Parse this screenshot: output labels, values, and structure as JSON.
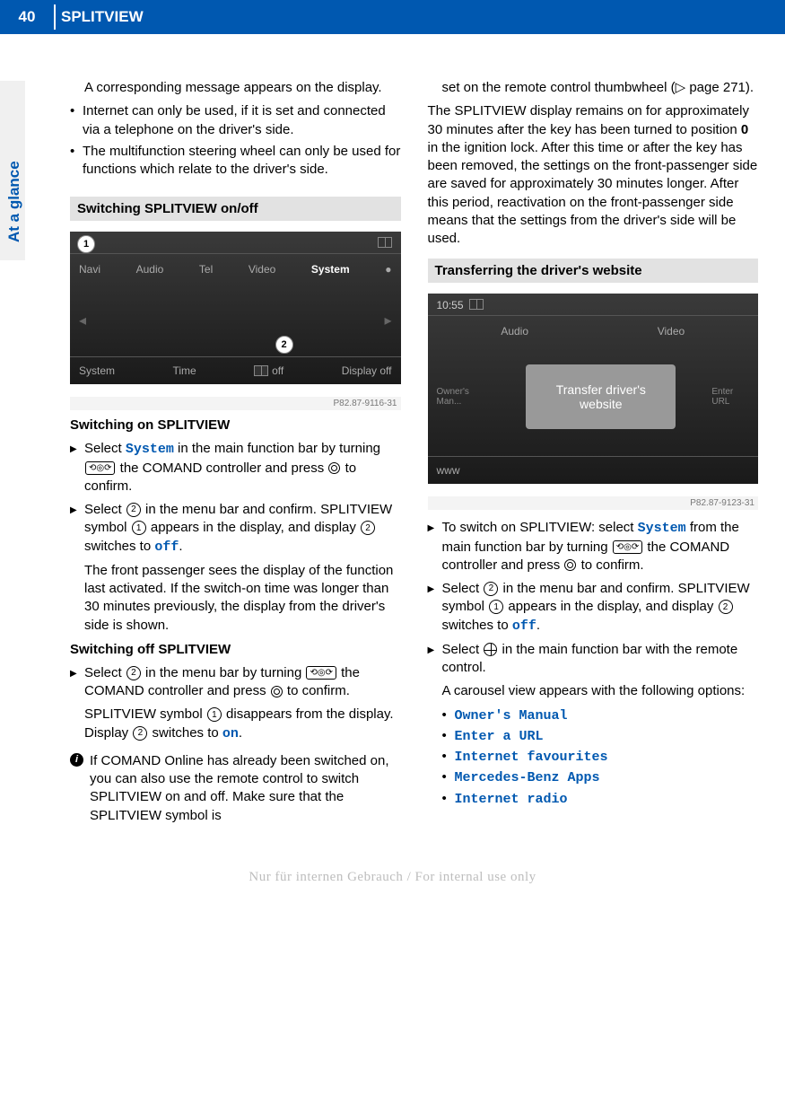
{
  "header": {
    "page_number": "40",
    "chapter": "SPLITVIEW",
    "side_tab": "At a glance"
  },
  "left": {
    "intro": "A corresponding message appears on the display.",
    "bul1": "Internet can only be used, if it is set and connected via a telephone on the driver's side.",
    "bul2": "The multifunction steering wheel can only be used for functions which relate to the driver's side.",
    "section1": "Switching SPLITVIEW on/off",
    "screenshot": {
      "nav": {
        "i1": "Navi",
        "i2": "Audio",
        "i3": "Tel",
        "i4": "Video",
        "i5": "System"
      },
      "bot": {
        "i1": "System",
        "i2": "Time",
        "i3": "off",
        "i4": "Display off"
      },
      "id": "P82.87-9116-31"
    },
    "swon_head": "Switching on SPLITVIEW",
    "swon_s1a": "Select ",
    "swon_s1_cmd": "System",
    "swon_s1b": " in the main function bar by turning ",
    "swon_s1c": " the COMAND controller and press ",
    "swon_s1d": " to confirm.",
    "swon_s2a": "Select ",
    "swon_s2b": " in the menu bar and confirm. SPLITVIEW symbol ",
    "swon_s2c": " appears in the display, and display ",
    "swon_s2d": " switches to ",
    "swon_s2_cmd": "off",
    "swon_s2e": ".",
    "swon_body": "The front passenger sees the display of the function last activated. If the switch-on time was longer than 30 minutes previously, the display from the driver's side is shown.",
    "swoff_head": "Switching off SPLITVIEW",
    "swoff_s1a": "Select ",
    "swoff_s1b": " in the menu bar by turning ",
    "swoff_s1c": " the COMAND controller and press ",
    "swoff_s1d": " to confirm.",
    "swoff_body1": "SPLITVIEW symbol ",
    "swoff_body2": " disappears from the display. Display ",
    "swoff_body3": " switches to ",
    "swoff_cmd": "on",
    "swoff_body4": ".",
    "note": "If COMAND Online has already been switched on, you can also use the remote control to switch SPLITVIEW on and off. Make sure that the SPLITVIEW symbol is"
  },
  "right": {
    "cont1": "set on the remote control thumbwheel (▷ page 271).",
    "para": "The SPLITVIEW display remains on for approximately 30 minutes after the key has been turned to position 0 in the ignition lock. After this time or after the key has been removed, the settings on the front-passenger side are saved for approximately 30 minutes longer. After this period, reactivation on the front-passenger side means that the settings from the driver's side will be used.",
    "section2": "Transferring the driver's website",
    "screenshot": {
      "tl": "10:55",
      "nav": {
        "i1": "Audio",
        "i2": "Video"
      },
      "owner": "Owner's Man...",
      "enter": "Enter URL",
      "transfer": "Transfer driver's website",
      "www": "www",
      "id": "P82.87-9123-31"
    },
    "s1a": "To switch on SPLITVIEW: select ",
    "s1_cmd": "System",
    "s1b": " from the main function bar by turning ",
    "s1c": " the COMAND controller and press ",
    "s1d": " to confirm.",
    "s2a": "Select ",
    "s2b": " in the menu bar and confirm. SPLITVIEW symbol ",
    "s2c": " appears in the display, and display ",
    "s2d": " switches to ",
    "s2_cmd": "off",
    "s2e": ".",
    "s3a": "Select ",
    "s3b": " in the main function bar with the remote control.",
    "carousel_intro": "A carousel view appears with the following options:",
    "carousel": {
      "i1": "Owner's Manual",
      "i2": "Enter a URL",
      "i3": "Internet favourites",
      "i4": "Mercedes-Benz Apps",
      "i5": "Internet radio"
    }
  },
  "footer": "Nur für internen Gebrauch / For internal use only"
}
